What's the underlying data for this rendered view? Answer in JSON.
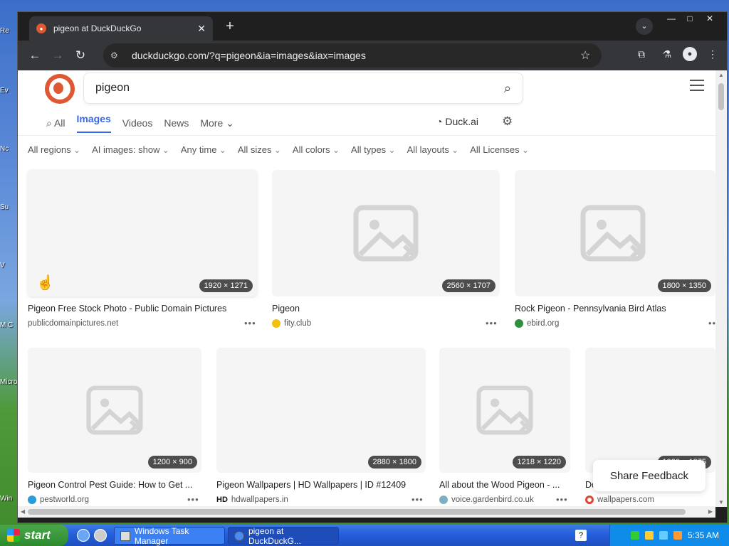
{
  "desktop": {
    "labels": [
      "Re",
      "Ev",
      "Nc",
      "Su",
      "V",
      "M C",
      "Micro Stu",
      "Win"
    ]
  },
  "browser": {
    "tab_title": "pigeon at DuckDuckGo",
    "close_glyph": "✕",
    "newtab_glyph": "+",
    "url": "duckduckgo.com/?q=pigeon&ia=images&iax=images",
    "window_controls": {
      "minimize": "—",
      "maximize": "□",
      "close": "✕"
    }
  },
  "page": {
    "search_query": "pigeon",
    "nav_tabs": [
      {
        "label": "All",
        "active": false
      },
      {
        "label": "Images",
        "active": true
      },
      {
        "label": "Videos",
        "active": false
      },
      {
        "label": "News",
        "active": false
      },
      {
        "label": "More",
        "active": false
      }
    ],
    "duck_ai": "Duck.ai",
    "filters": [
      "All regions",
      "AI images: show",
      "Any time",
      "All sizes",
      "All colors",
      "All types",
      "All layouts",
      "All Licenses"
    ],
    "results": [
      {
        "title": "Pigeon Free Stock Photo - Public Domain Pictures",
        "source": "publicdomainpictures.net",
        "dims": "1920 × 1271",
        "fav_color": ""
      },
      {
        "title": "Pigeon",
        "source": "fity.club",
        "dims": "2560 × 1707",
        "fav_color": "#f2c10f"
      },
      {
        "title": "Rock Pigeon - Pennsylvania Bird Atlas",
        "source": "ebird.org",
        "dims": "1800 × 1350",
        "fav_color": "#2f8f3e"
      },
      {
        "title": "Pigeon Control Pest Guide: How to Get ...",
        "source": "pestworld.org",
        "dims": "1200 × 900",
        "fav_color": "#2b9cd8"
      },
      {
        "title": "Pigeon Wallpapers | HD Wallpapers | ID #12409",
        "source": "hdwallpapers.in",
        "dims": "2880 × 1800",
        "fav_color": "#111111"
      },
      {
        "title": "All about the Wood Pigeon - ...",
        "source": "voice.gardenbird.co.uk",
        "dims": "1218 × 1220",
        "fav_color": "#7fb0c0"
      },
      {
        "title": "Do",
        "source": "wallpapers.com",
        "dims": "1920 × 1875",
        "fav_color": "#e0452f"
      }
    ],
    "share_feedback": "Share Feedback"
  },
  "taskbar": {
    "start": "start",
    "items": [
      {
        "label": "Windows Task Manager",
        "active": false
      },
      {
        "label": "pigeon at DuckDuckG...",
        "active": true
      }
    ],
    "clock": "5:35 AM"
  }
}
